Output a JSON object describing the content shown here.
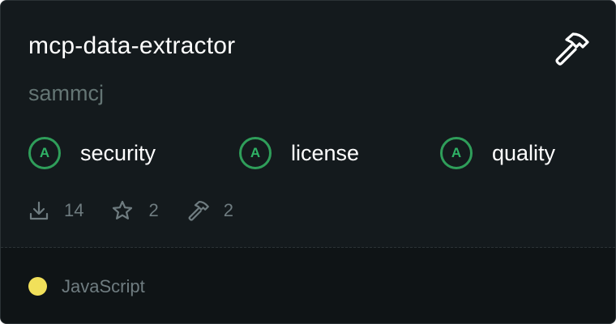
{
  "card": {
    "title": "mcp-data-extractor",
    "author": "sammcj",
    "hammer_icon": "hammer-icon"
  },
  "scores": [
    {
      "grade": "A",
      "label": "security"
    },
    {
      "grade": "A",
      "label": "license"
    },
    {
      "grade": "A",
      "label": "quality"
    }
  ],
  "stats": {
    "downloads": "14",
    "stars": "2",
    "tools": "2"
  },
  "footer": {
    "language": "JavaScript",
    "language_color": "#f1e05a"
  },
  "colors": {
    "background": "#141a1d",
    "footer_background": "#0f1416",
    "grade_green": "#2f9e5a",
    "muted_text": "#647574"
  }
}
